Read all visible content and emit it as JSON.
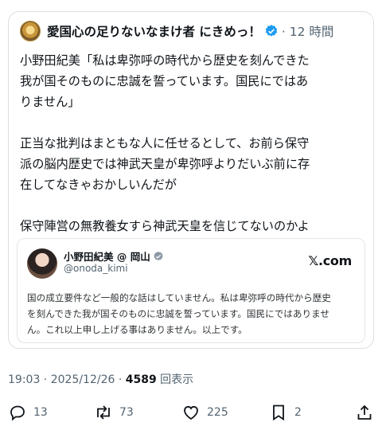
{
  "post": {
    "author": "愛国心の足りないなまけ者 にきめっ！",
    "time": "· 12 時間",
    "lines": [
      "小野田紀美「私は卑弥呼の時代から歴史を刻んできた",
      "我が国そのものに忠誠を誓っています。国民にではあ",
      "りません」",
      "",
      "正当な批判はまともな人に任せるとして、お前ら保守",
      "派の脳内歴史では神武天皇が卑弥呼よりだいぶ前に存",
      "在してなきゃおかしいんだが",
      "",
      "保守陣営の無教養女すら神武天皇を信じてないのかよ"
    ]
  },
  "quote": {
    "name": "小野田紀美 @ 岡山",
    "handle": "@onoda_kimi",
    "source": "𝕏.com",
    "lines": [
      "国の成立要件など一般的な話はしていません。私は卑弥呼の時代から歴史",
      "を刻んできた我が国そのものに忠誠を誓っています。国民にではありませ",
      "ん。これ以上申し上げる事はありません。以上です。"
    ]
  },
  "meta": {
    "timestamp": "19:03 · 2025/12/26 · ",
    "views": "4589",
    "views_label": " 回表示"
  },
  "actions": {
    "replies": "13",
    "reposts": "73",
    "likes": "225",
    "bookmarks": "2"
  },
  "colors": {
    "accent": "#1d9bf0",
    "muted": "#536471",
    "text": "#0f1419"
  }
}
